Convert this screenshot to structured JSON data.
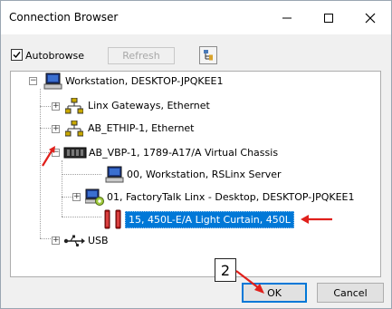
{
  "window": {
    "title": "Connection Browser",
    "minimize_icon": "minimize-icon",
    "maximize_icon": "maximize-icon",
    "close_icon": "close-icon"
  },
  "toolbar": {
    "autobrowse_label": "Autobrowse",
    "autobrowse_checked": true,
    "refresh_label": "Refresh",
    "refresh_enabled": false,
    "tree_view_icon": "tree-view-icon"
  },
  "tree": {
    "nodes": [
      {
        "label": "Workstation, DESKTOP-JPQKEE1",
        "icon": "workstation-icon",
        "expander": "-"
      },
      {
        "label": "Linx Gateways, Ethernet",
        "icon": "network-icon",
        "expander": "+"
      },
      {
        "label": "AB_ETHIP-1, Ethernet",
        "icon": "network-icon",
        "expander": "+"
      },
      {
        "label": "AB_VBP-1, 1789-A17/A Virtual Chassis",
        "icon": "chassis-icon",
        "expander": "-"
      },
      {
        "label": "00, Workstation, RSLinx Server",
        "icon": "workstation-icon",
        "expander": ""
      },
      {
        "label": "01, FactoryTalk Linx - Desktop, DESKTOP-JPQKEE1",
        "icon": "factorytalk-linx-icon",
        "expander": "+"
      },
      {
        "label": "15, 450L-E/A Light Curtain, 450L",
        "icon": "light-curtain-icon",
        "expander": "",
        "selected": true
      },
      {
        "label": "USB",
        "icon": "usb-icon",
        "expander": "+"
      }
    ]
  },
  "buttons": {
    "ok_label": "OK",
    "cancel_label": "Cancel"
  },
  "annotation": {
    "step_number": "2",
    "color": "#e0201b"
  },
  "colors": {
    "selection": "#0078d7",
    "focus_border": "#0078d7"
  }
}
